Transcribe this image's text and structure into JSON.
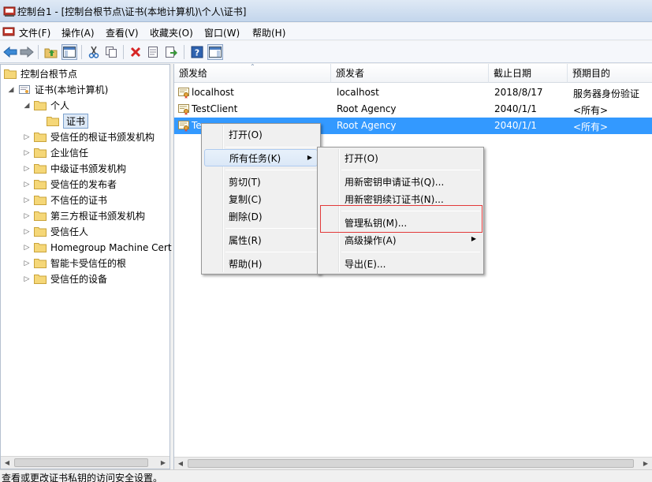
{
  "window": {
    "title": "控制台1 - [控制台根节点\\证书(本地计算机)\\个人\\证书]"
  },
  "menubar": [
    "文件(F)",
    "操作(A)",
    "查看(V)",
    "收藏夹(O)",
    "窗口(W)",
    "帮助(H)"
  ],
  "toolbar": [
    "back-icon",
    "forward-icon",
    "up-folder-icon",
    "show-tree-icon",
    "cut-icon",
    "copy-icon",
    "delete-icon",
    "properties-icon",
    "export-icon",
    "help-icon",
    "action-pane-icon"
  ],
  "tree": [
    "控制台根节点",
    "证书(本地计算机)",
    "个人",
    "证书",
    "受信任的根证书颁发机构",
    "企业信任",
    "中级证书颁发机构",
    "受信任的发布者",
    "不信任的证书",
    "第三方根证书颁发机构",
    "受信任人",
    "Homegroup Machine Cert",
    "智能卡受信任的根",
    "受信任的设备"
  ],
  "columns": [
    "颁发给",
    "颁发者",
    "截止日期",
    "预期目的"
  ],
  "rows": [
    [
      "localhost",
      "localhost",
      "2018/8/17",
      "服务器身份验证"
    ],
    [
      "TestClient",
      "Root Agency",
      "2040/1/1",
      "<所有>"
    ],
    [
      "Te",
      "Root Agency",
      "2040/1/1",
      "<所有>"
    ]
  ],
  "context_menu": [
    "打开(O)",
    "所有任务(K)",
    "剪切(T)",
    "复制(C)",
    "删除(D)",
    "属性(R)",
    "帮助(H)"
  ],
  "submenu": [
    "打开(O)",
    "用新密钥申请证书(Q)...",
    "用新密钥续订证书(N)...",
    "管理私钥(M)...",
    "高级操作(A)",
    "导出(E)..."
  ],
  "status": "查看或更改证书私钥的访问安全设置。",
  "colors": {
    "selection": "#3399ff",
    "highlight_box": "#e23a3a"
  }
}
